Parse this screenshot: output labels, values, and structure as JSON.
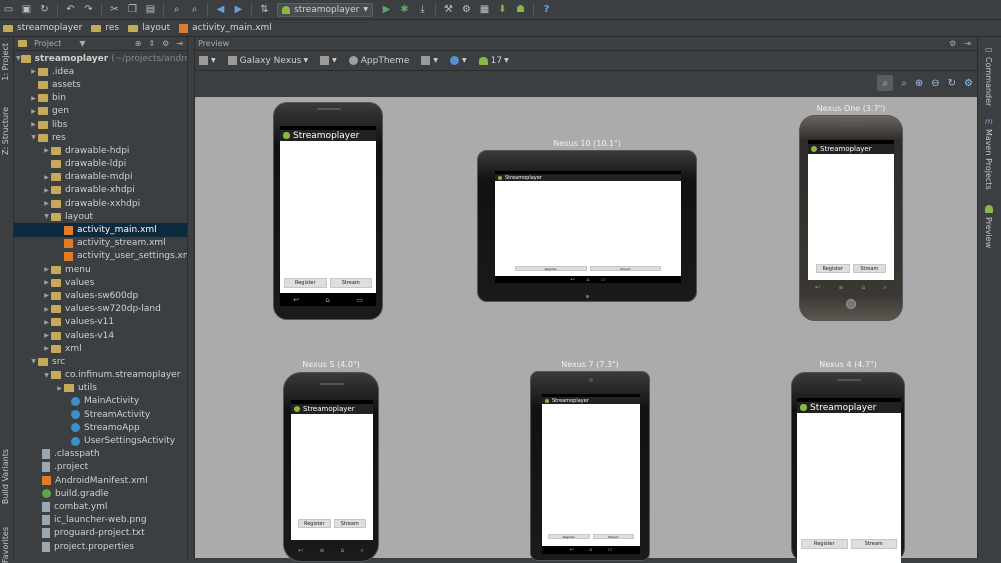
{
  "toolbar": {
    "run_config": "streamoplayer",
    "help_icon": "?"
  },
  "breadcrumbs": [
    "streamoplayer",
    "res",
    "layout",
    "activity_main.xml"
  ],
  "left_strip": {
    "project_tab": "1: Project",
    "structure_tab": "Z: Structure",
    "build_variants_tab": "Build Variants",
    "favorites_tab": "Favorites"
  },
  "project_panel": {
    "title": "Project",
    "root_name": "streamoplayer",
    "root_path": "(~/projects/android",
    "items": [
      {
        "label": ".idea"
      },
      {
        "label": "assets"
      },
      {
        "label": "bin"
      },
      {
        "label": "gen"
      },
      {
        "label": "libs"
      },
      {
        "label": "res"
      },
      {
        "label": "drawable-hdpi"
      },
      {
        "label": "drawable-ldpi"
      },
      {
        "label": "drawable-mdpi"
      },
      {
        "label": "drawable-xhdpi"
      },
      {
        "label": "drawable-xxhdpi"
      },
      {
        "label": "layout"
      },
      {
        "label": "activity_main.xml"
      },
      {
        "label": "activity_stream.xml"
      },
      {
        "label": "activity_user_settings.xml"
      },
      {
        "label": "menu"
      },
      {
        "label": "values"
      },
      {
        "label": "values-sw600dp"
      },
      {
        "label": "values-sw720dp-land"
      },
      {
        "label": "values-v11"
      },
      {
        "label": "values-v14"
      },
      {
        "label": "xml"
      },
      {
        "label": "src"
      },
      {
        "label": "co.infinum.streamoplayer"
      },
      {
        "label": "utils"
      },
      {
        "label": "MainActivity"
      },
      {
        "label": "StreamActivity"
      },
      {
        "label": "StreamoApp"
      },
      {
        "label": "UserSettingsActivity"
      },
      {
        "label": ".classpath"
      },
      {
        "label": ".project"
      },
      {
        "label": "AndroidManifest.xml"
      },
      {
        "label": "build.gradle"
      },
      {
        "label": "combat.yml"
      },
      {
        "label": "ic_launcher-web.png"
      },
      {
        "label": "proguard-project.txt"
      },
      {
        "label": "project.properties"
      }
    ]
  },
  "preview": {
    "title": "Preview",
    "device_selector": "Galaxy Nexus",
    "theme": "AppTheme",
    "api_level": "17"
  },
  "right_strip": {
    "commander_tab": "Commander",
    "maven_tab": "Maven Projects",
    "preview_tab": "Preview"
  },
  "app": {
    "title": "Streamoplayer",
    "register_button": "Register",
    "stream_button": "Stream"
  },
  "devices": {
    "galaxy_nexus": "",
    "nexus_10": "Nexus 10 (10.1\")",
    "nexus_one": "Nexus One (3.7\")",
    "nexus_s": "Nexus S (4.0\")",
    "nexus_7": "Nexus 7 (7.3\")",
    "nexus_4": "Nexus 4 (4.7\")"
  }
}
